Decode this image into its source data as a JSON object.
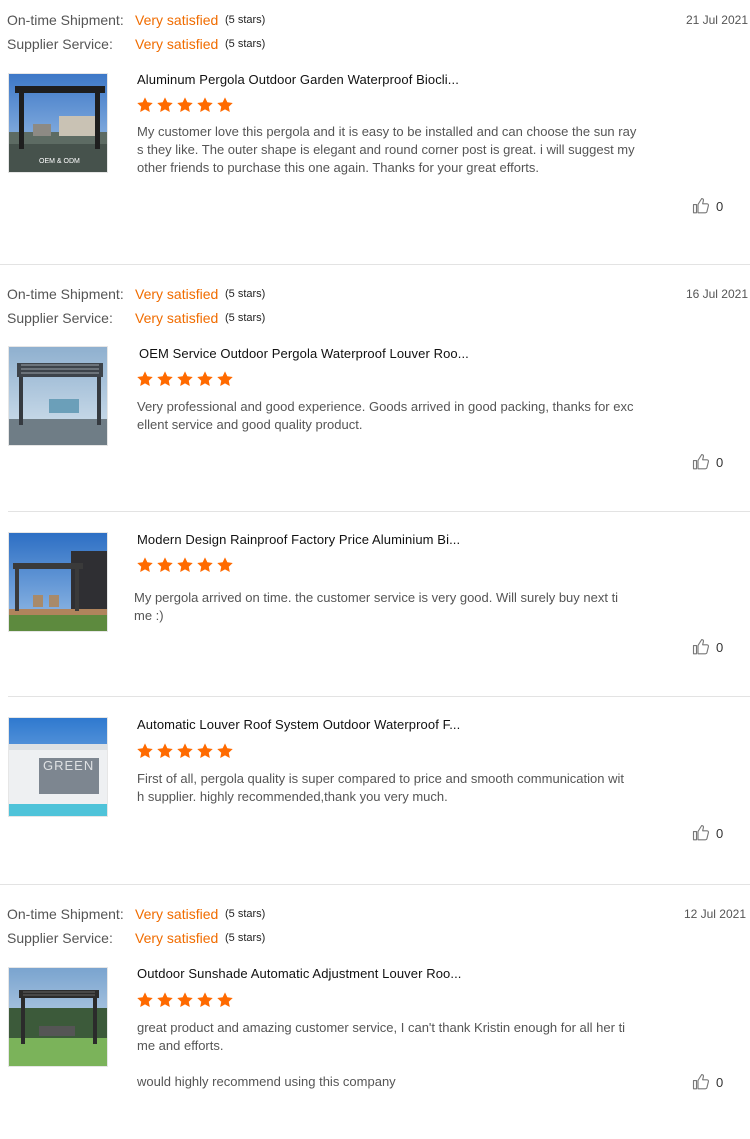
{
  "reviews": [
    {
      "meta": {
        "shipment_label": "On-time Shipment:",
        "shipment_value": "Very satisfied",
        "shipment_stars": "(5 stars)",
        "service_label": "Supplier Service:",
        "service_value": "Very satisfied",
        "service_stars": "(5 stars)",
        "date": "21 Jul 2021"
      },
      "product_title": "Aluminum Pergola Outdoor Garden Waterproof Biocli...",
      "image_caption": "OEM & ODM",
      "rating": 5,
      "text": "My customer love this pergola and it is easy to be installed and can choose the sun rays they like. The outer shape is elegant and round corner post is great. i will suggest my other friends to purchase this one again. Thanks for your great efforts.",
      "likes": "0"
    },
    {
      "meta": {
        "shipment_label": "On-time Shipment:",
        "shipment_value": "Very satisfied",
        "shipment_stars": "(5 stars)",
        "service_label": "Supplier Service:",
        "service_value": "Very satisfied",
        "service_stars": "(5 stars)",
        "date": "16 Jul 2021"
      },
      "product_title": "OEM Service Outdoor Pergola Waterproof Louver Roo...",
      "rating": 5,
      "text": "Very professional and good experience. Goods arrived in good packing, thanks for excellent service and good quality product.",
      "likes": "0"
    },
    {
      "product_title": "Modern Design Rainproof Factory Price Aluminium Bi...",
      "rating": 5,
      "text": "My pergola arrived on time. the customer service is very good. Will surely buy next time :)",
      "likes": "0"
    },
    {
      "product_title": "Automatic Louver Roof System Outdoor Waterproof F...",
      "image_caption": "GREEN",
      "rating": 5,
      "text": "First of all, pergola quality is super compared to price and smooth communication with supplier. highly recommended,thank you very much.",
      "likes": "0"
    },
    {
      "meta": {
        "shipment_label": "On-time Shipment:",
        "shipment_value": "Very satisfied",
        "shipment_stars": "(5 stars)",
        "service_label": "Supplier Service:",
        "service_value": "Very satisfied",
        "service_stars": "(5 stars)",
        "date": "12 Jul 2021"
      },
      "product_title": "Outdoor Sunshade Automatic Adjustment Louver Roo...",
      "rating": 5,
      "text": "great product and amazing customer service, I can't thank Kristin enough for all her time and efforts.",
      "extra_text": "would highly recommend using this company",
      "likes": "0"
    }
  ],
  "colors": {
    "satisfied": "#f06c00",
    "star": "#ff6a00",
    "divider": "#e3e3e3"
  }
}
